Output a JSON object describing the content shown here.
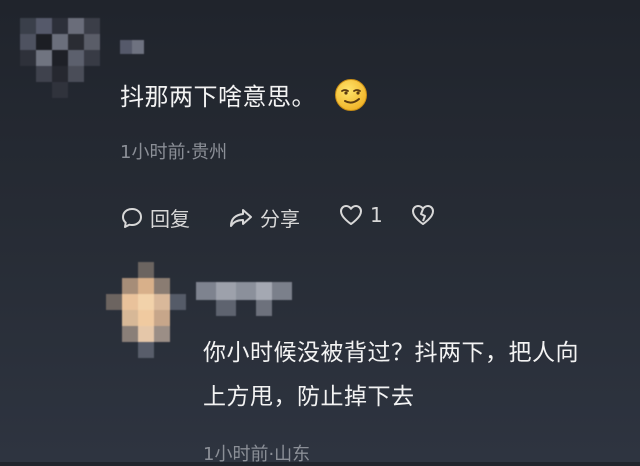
{
  "comments": [
    {
      "text": "抖那两下啥意思。",
      "emoji": "smirk-face-icon",
      "meta": "1小时前·贵州",
      "actions": {
        "reply_label": "回复",
        "share_label": "分享",
        "like_count": "1"
      }
    },
    {
      "text_line1": "你小时候没被背过？抖两下，把人向",
      "text_line2": "上方甩，防止掉下去",
      "meta": "1小时前·山东"
    }
  ],
  "colors": {
    "background": "#262b34",
    "text": "#f3f3f3",
    "meta": "#8b8f97"
  }
}
